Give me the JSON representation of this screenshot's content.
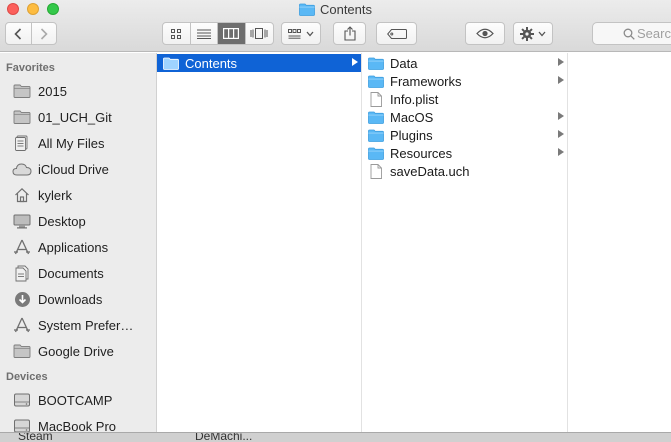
{
  "window": {
    "title": "Contents"
  },
  "toolbar": {
    "back_icon": "chevron-left-icon",
    "forward_icon": "chevron-right-icon",
    "view_modes": [
      "icon-view",
      "list-view",
      "column-view",
      "cover-flow-view"
    ],
    "active_view": "column-view",
    "search_placeholder": "Search"
  },
  "sidebar": {
    "favorites_header": "Favorites",
    "favorites": [
      {
        "label": "2015",
        "icon": "folder-icon"
      },
      {
        "label": "01_UCH_Git",
        "icon": "folder-icon"
      },
      {
        "label": "All My Files",
        "icon": "all-files-icon"
      },
      {
        "label": "iCloud Drive",
        "icon": "cloud-icon"
      },
      {
        "label": "kylerk",
        "icon": "home-icon"
      },
      {
        "label": "Desktop",
        "icon": "desktop-icon"
      },
      {
        "label": "Applications",
        "icon": "applications-icon"
      },
      {
        "label": "Documents",
        "icon": "documents-icon"
      },
      {
        "label": "Downloads",
        "icon": "downloads-icon"
      },
      {
        "label": "System Prefer…",
        "icon": "applications-icon"
      },
      {
        "label": "Google Drive",
        "icon": "folder-icon"
      }
    ],
    "devices_header": "Devices",
    "devices": [
      {
        "label": "BOOTCAMP",
        "icon": "disk-icon"
      },
      {
        "label": "MacBook Pro",
        "icon": "disk-icon"
      }
    ]
  },
  "column1": [
    {
      "label": "Contents",
      "type": "folder",
      "selected": true
    }
  ],
  "column2": [
    {
      "label": "Data",
      "type": "folder"
    },
    {
      "label": "Frameworks",
      "type": "folder"
    },
    {
      "label": "Info.plist",
      "type": "file"
    },
    {
      "label": "MacOS",
      "type": "folder"
    },
    {
      "label": "Plugins",
      "type": "folder"
    },
    {
      "label": "Resources",
      "type": "folder"
    },
    {
      "label": "saveData.uch",
      "type": "file"
    }
  ],
  "peek": {
    "left_text": "Steam",
    "right_text": "DeMachi..."
  },
  "colors": {
    "selection": "#0f63d6",
    "folder": "#5ab8f5"
  }
}
